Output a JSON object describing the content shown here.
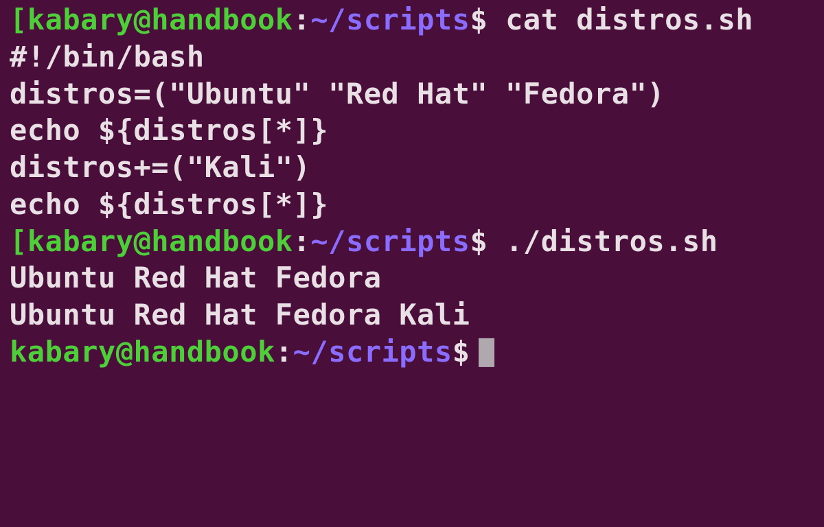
{
  "prompt": {
    "user_host": "kabary@handbook",
    "colon": ":",
    "path": "~/scripts",
    "dollar": "$"
  },
  "session": [
    {
      "command": "cat distros.sh",
      "output": [
        "#!/bin/bash",
        "",
        "distros=(\"Ubuntu\" \"Red Hat\" \"Fedora\")",
        "",
        "echo ${distros[*]}",
        "",
        "distros+=(\"Kali\")",
        "",
        "echo ${distros[*]}"
      ]
    },
    {
      "command": "./distros.sh",
      "output": [
        "Ubuntu Red Hat Fedora",
        "Ubuntu Red Hat Fedora Kali"
      ]
    }
  ],
  "colors": {
    "background": "#4a0e3a",
    "text": "#e8e0e4",
    "user_host": "#4ecf3a",
    "path": "#8a6cff",
    "cursor": "#b0a8ae"
  }
}
